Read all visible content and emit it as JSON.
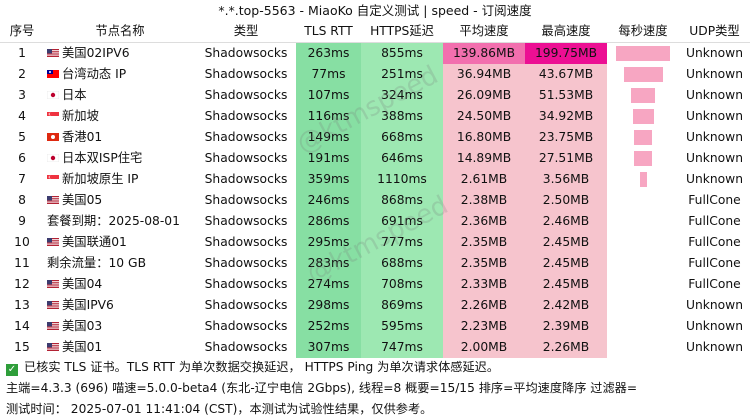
{
  "title": "*.*.top-5563 - MiaoKo 自定义测试 | speed - 订阅速度",
  "headers": [
    "序号",
    "节点名称",
    "类型",
    "TLS RTT",
    "HTTPS延迟",
    "平均速度",
    "最高速度",
    "每秒速度",
    "UDP类型"
  ],
  "colors": {
    "rtt_bg": "#87dfa3",
    "https_bg": "#9de8b2",
    "avg_top": "#f26fae",
    "max_top": "#ec0f93",
    "avg_bg": "#f6c4cd",
    "max_bg": "#f6c4cd",
    "spark": "#f7a6c2"
  },
  "rows": [
    {
      "idx": "1",
      "flag": "us",
      "name": "美国02IPV6",
      "type": "Shadowsocks",
      "rtt": "263ms",
      "https": "855ms",
      "avg": "139.86MB",
      "max": "199.75MB",
      "spark": 0.9,
      "udp": "Unknown"
    },
    {
      "idx": "2",
      "flag": "tw",
      "name": "台湾动态 IP",
      "type": "Shadowsocks",
      "rtt": "77ms",
      "https": "251ms",
      "avg": "36.94MB",
      "max": "43.67MB",
      "spark": 0.65,
      "udp": "Unknown"
    },
    {
      "idx": "3",
      "flag": "jp",
      "name": "日本",
      "type": "Shadowsocks",
      "rtt": "107ms",
      "https": "324ms",
      "avg": "26.09MB",
      "max": "51.53MB",
      "spark": 0.4,
      "udp": "Unknown"
    },
    {
      "idx": "4",
      "flag": "sg",
      "name": "新加坡",
      "type": "Shadowsocks",
      "rtt": "116ms",
      "https": "388ms",
      "avg": "24.50MB",
      "max": "34.92MB",
      "spark": 0.35,
      "udp": "Unknown"
    },
    {
      "idx": "5",
      "flag": "hk",
      "name": "香港01",
      "type": "Shadowsocks",
      "rtt": "149ms",
      "https": "668ms",
      "avg": "16.80MB",
      "max": "23.75MB",
      "spark": 0.3,
      "udp": "Unknown"
    },
    {
      "idx": "6",
      "flag": "jp",
      "name": "日本双ISP住宅",
      "type": "Shadowsocks",
      "rtt": "191ms",
      "https": "646ms",
      "avg": "14.89MB",
      "max": "27.51MB",
      "spark": 0.3,
      "udp": "Unknown"
    },
    {
      "idx": "7",
      "flag": "sg",
      "name": "新加坡原生 IP",
      "type": "Shadowsocks",
      "rtt": "359ms",
      "https": "1110ms",
      "avg": "2.61MB",
      "max": "3.56MB",
      "spark": 0.12,
      "udp": "Unknown"
    },
    {
      "idx": "8",
      "flag": "us",
      "name": "美国05",
      "type": "Shadowsocks",
      "rtt": "246ms",
      "https": "868ms",
      "avg": "2.38MB",
      "max": "2.50MB",
      "spark": 0.0,
      "udp": "FullCone"
    },
    {
      "idx": "9",
      "flag": "",
      "name": "套餐到期：2025-08-01",
      "type": "Shadowsocks",
      "rtt": "286ms",
      "https": "691ms",
      "avg": "2.36MB",
      "max": "2.46MB",
      "spark": 0.0,
      "udp": "FullCone"
    },
    {
      "idx": "10",
      "flag": "us",
      "name": "美国联通01",
      "type": "Shadowsocks",
      "rtt": "295ms",
      "https": "777ms",
      "avg": "2.35MB",
      "max": "2.45MB",
      "spark": 0.0,
      "udp": "FullCone"
    },
    {
      "idx": "11",
      "flag": "",
      "name": "剩余流量：10 GB",
      "type": "Shadowsocks",
      "rtt": "283ms",
      "https": "688ms",
      "avg": "2.35MB",
      "max": "2.45MB",
      "spark": 0.0,
      "udp": "FullCone"
    },
    {
      "idx": "12",
      "flag": "us",
      "name": "美国04",
      "type": "Shadowsocks",
      "rtt": "274ms",
      "https": "708ms",
      "avg": "2.33MB",
      "max": "2.45MB",
      "spark": 0.0,
      "udp": "FullCone"
    },
    {
      "idx": "13",
      "flag": "us",
      "name": "美国IPV6",
      "type": "Shadowsocks",
      "rtt": "298ms",
      "https": "869ms",
      "avg": "2.26MB",
      "max": "2.42MB",
      "spark": 0.0,
      "udp": "Unknown"
    },
    {
      "idx": "14",
      "flag": "us",
      "name": "美国03",
      "type": "Shadowsocks",
      "rtt": "252ms",
      "https": "595ms",
      "avg": "2.23MB",
      "max": "2.39MB",
      "spark": 0.0,
      "udp": "Unknown"
    },
    {
      "idx": "15",
      "flag": "us",
      "name": "美国01",
      "type": "Shadowsocks",
      "rtt": "307ms",
      "https": "747ms",
      "avg": "2.00MB",
      "max": "2.26MB",
      "spark": 0.0,
      "udp": "Unknown"
    }
  ],
  "footer": {
    "line1": "已核实 TLS 证书。TLS RTT 为单次数据交换延迟， HTTPS Ping 为单次请求体感延迟。",
    "line2": "主端=4.3.3 (696) 喵速=5.0.0-beta4 (东北-辽宁电信 2Gbps), 线程=8 概要=15/15 排序=平均速度降序 过滤器=",
    "line3": "测试时间： 2025-07-01 11:41:04 (CST)，本测试为试验性结果，仅供参考。"
  },
  "watermark": "@ktmspeed"
}
